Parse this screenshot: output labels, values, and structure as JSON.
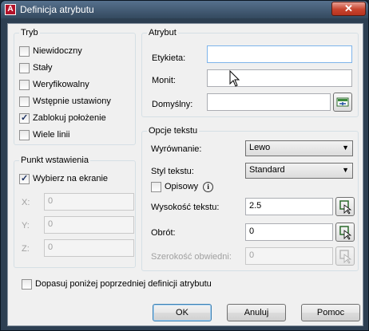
{
  "window": {
    "title": "Definicja atrybutu",
    "close_glyph": "✕",
    "icon": "autocad-icon"
  },
  "mode": {
    "title": "Tryb",
    "items": [
      {
        "label": "Niewidoczny",
        "checked": false
      },
      {
        "label": "Stały",
        "checked": false
      },
      {
        "label": "Weryfikowalny",
        "checked": false
      },
      {
        "label": "Wstępnie ustawiony",
        "checked": false
      },
      {
        "label": "Zablokuj położenie",
        "checked": true
      },
      {
        "label": "Wiele linii",
        "checked": false
      }
    ]
  },
  "insertion": {
    "title": "Punkt wstawienia",
    "specify_on_screen": {
      "label": "Wybierz na ekranie",
      "checked": true
    },
    "x": {
      "label": "X:",
      "value": "0"
    },
    "y": {
      "label": "Y:",
      "value": "0"
    },
    "z": {
      "label": "Z:",
      "value": "0"
    }
  },
  "attribute": {
    "title": "Atrybut",
    "tag": {
      "label": "Etykieta:",
      "value": ""
    },
    "prompt": {
      "label": "Monit:",
      "value": ""
    },
    "default": {
      "label": "Domyślny:",
      "value": ""
    }
  },
  "text": {
    "title": "Opcje tekstu",
    "justification": {
      "label": "Wyrównanie:",
      "value": "Lewo"
    },
    "style": {
      "label": "Styl tekstu:",
      "value": "Standard"
    },
    "annotative": {
      "label": "Opisowy",
      "checked": false
    },
    "height": {
      "label": "Wysokość tekstu:",
      "value": "2.5"
    },
    "rotation": {
      "label": "Obrót:",
      "value": "0"
    },
    "boundary": {
      "label": "Szerokość obwiedni:",
      "value": "0"
    }
  },
  "align_below": {
    "label": "Dopasuj poniżej poprzedniej definicji atrybutu",
    "checked": false
  },
  "buttons": {
    "ok": "OK",
    "cancel": "Anuluj",
    "help": "Pomoc"
  },
  "colors": {
    "title_bar": "#34495f",
    "close": "#c7432d",
    "focus": "#7eb4ea"
  }
}
